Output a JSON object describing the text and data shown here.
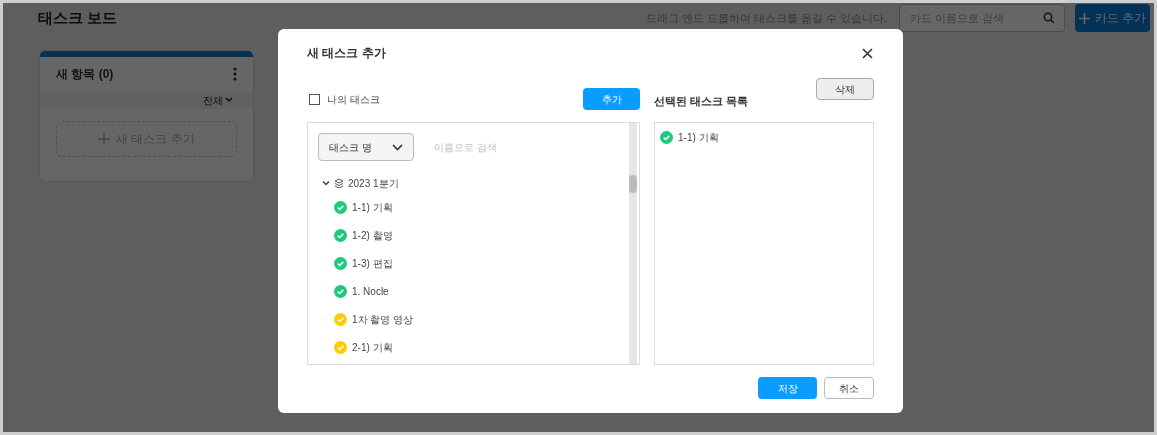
{
  "board": {
    "title": "태스크 보드",
    "hint": "드래그 앤드 드롭하여 태스크를 옮길 수 있습니다.",
    "search": {
      "placeholder": "카드 이름으로 검색"
    },
    "add_card_button": "카드 추가",
    "column": {
      "title": "새 항목 (0)",
      "filter": "전체",
      "add_task": "새 태스크 추가"
    }
  },
  "dialog": {
    "title": "새 태스크 추가",
    "my_tasks": {
      "label": "나의 태스크",
      "checked": false
    },
    "add_button": "추가",
    "filter_dropdown": "태스크 명",
    "search": {
      "placeholder": "이름으로 검색"
    },
    "tree": [
      {
        "label": "2023 1분기",
        "expanded": true,
        "children": [
          {
            "label": "1-1) 기획",
            "color": "#1ec97d"
          },
          {
            "label": "1-2) 촬영",
            "color": "#1ec97d"
          },
          {
            "label": "1-3) 편집",
            "color": "#1ec97d"
          },
          {
            "label": "1. Nocle",
            "color": "#1ec97d"
          },
          {
            "label": "1차 촬영 영상",
            "color": "#ffcc00"
          },
          {
            "label": "2-1) 기획",
            "color": "#ffcc00"
          }
        ]
      }
    ],
    "selected_title": "선택된 태스크 목록",
    "delete_button": "삭제",
    "selected_tasks": [
      {
        "label": "1-1) 기획",
        "color": "#1ec97d"
      }
    ],
    "save_button": "저장",
    "cancel_button": "취소"
  }
}
